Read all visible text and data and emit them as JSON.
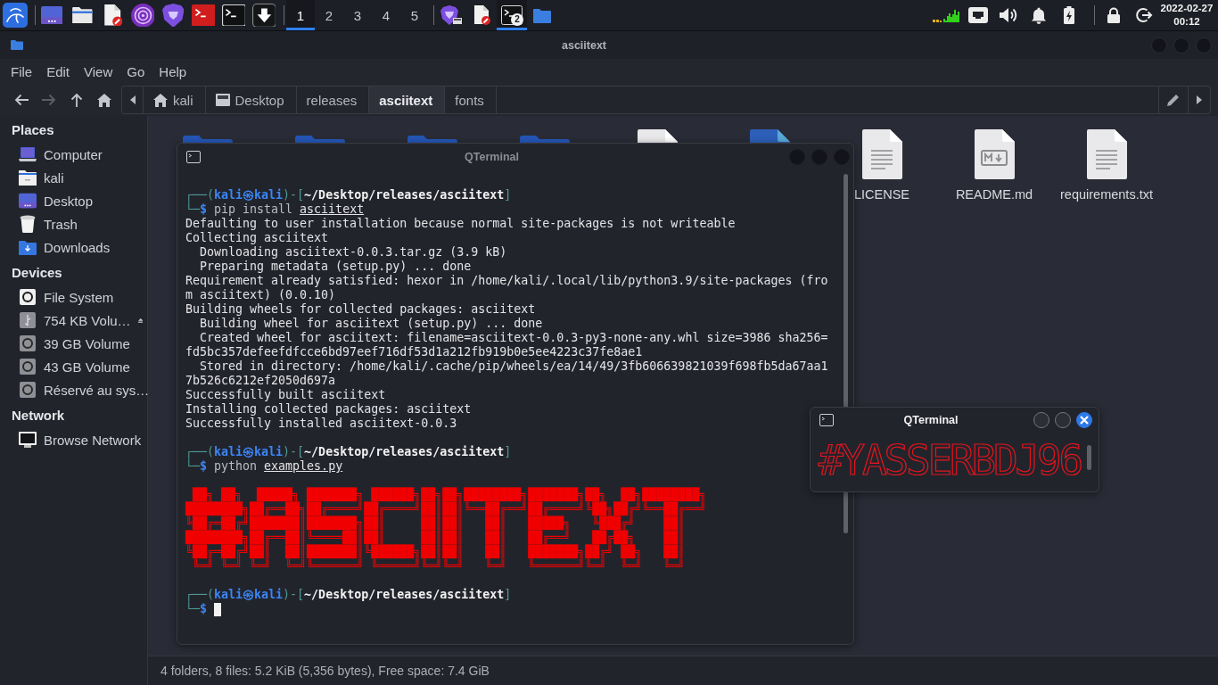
{
  "panel": {
    "launchers": [
      {
        "kind": "show_desktop"
      },
      {
        "kind": "files"
      },
      {
        "kind": "editor"
      },
      {
        "kind": "onion_browser"
      },
      {
        "kind": "browser"
      },
      {
        "kind": "root_terminal"
      },
      {
        "kind": "terminal"
      },
      {
        "kind": "downloader"
      }
    ],
    "workspaces": [
      {
        "label": "1",
        "selected": true
      },
      {
        "label": "2",
        "selected": false
      },
      {
        "label": "3",
        "selected": false
      },
      {
        "label": "4",
        "selected": false
      },
      {
        "label": "5",
        "selected": false
      }
    ],
    "tasks": [
      {
        "kind": "browser",
        "selected": false
      },
      {
        "kind": "editor",
        "selected": false
      },
      {
        "kind": "terminal",
        "badge": "2",
        "selected": true
      },
      {
        "kind": "files",
        "selected": false
      }
    ],
    "tray": [
      {
        "kind": "monitor"
      },
      {
        "kind": "network"
      },
      {
        "kind": "volume"
      },
      {
        "kind": "notifications"
      },
      {
        "kind": "battery"
      }
    ],
    "session": [
      {
        "kind": "lock"
      },
      {
        "kind": "logout"
      }
    ],
    "clock": {
      "date": "2022-02-27",
      "time": "00:12"
    }
  },
  "file_manager": {
    "title": "asciitext",
    "menu": [
      "File",
      "Edit",
      "View",
      "Go",
      "Help"
    ],
    "nav": [
      {
        "kind": "back",
        "disabled": false
      },
      {
        "kind": "forward",
        "disabled": true
      },
      {
        "kind": "up",
        "disabled": false
      },
      {
        "kind": "home",
        "disabled": false
      }
    ],
    "path": [
      {
        "label": "kali",
        "kind": "home",
        "selected": false
      },
      {
        "label": "Desktop",
        "kind": "desktop",
        "selected": false
      },
      {
        "label": "releases",
        "kind": "folder",
        "selected": false
      },
      {
        "label": "asciitext",
        "kind": "folder",
        "selected": true
      },
      {
        "label": "fonts",
        "kind": "folder",
        "selected": false
      }
    ],
    "sidebar": [
      {
        "heading": "Places",
        "items": [
          {
            "label": "Computer",
            "kind": "computer"
          },
          {
            "label": "kali",
            "kind": "home"
          },
          {
            "label": "Desktop",
            "kind": "desktop"
          },
          {
            "label": "Trash",
            "kind": "trash"
          },
          {
            "label": "Downloads",
            "kind": "downloads"
          }
        ]
      },
      {
        "heading": "Devices",
        "items": [
          {
            "label": "File System",
            "kind": "drive",
            "ejectable": false
          },
          {
            "label": "754 KB Volu…",
            "kind": "usb",
            "ejectable": true
          },
          {
            "label": "39 GB Volume",
            "kind": "disk",
            "ejectable": false
          },
          {
            "label": "43 GB Volume",
            "kind": "disk",
            "ejectable": false
          },
          {
            "label": "Réservé au sys…",
            "kind": "disk",
            "ejectable": false
          }
        ]
      },
      {
        "heading": "Network",
        "items": [
          {
            "label": "Browse Network",
            "kind": "network"
          }
        ]
      }
    ],
    "files": [
      {
        "kind": "folder"
      },
      {
        "kind": "folder"
      },
      {
        "kind": "folder"
      },
      {
        "kind": "folder"
      },
      {
        "kind": "text"
      },
      {
        "kind": "python"
      },
      {
        "kind": "text",
        "name": "LICENSE"
      },
      {
        "kind": "markdown",
        "name": "README.md"
      },
      {
        "kind": "text",
        "name": "requirements.txt"
      }
    ],
    "status": "4 folders, 8 files: 5.2 KiB (5,356 bytes), Free space: 7.4 GiB"
  },
  "terminals": [
    {
      "title": "QTerminal",
      "active": false,
      "lines": [
        {
          "kind": "prompt",
          "frame": "┌──(",
          "user": "kali㉿kali",
          "sep": ")-[",
          "path": "~/Desktop/releases/asciitext",
          "close": "]"
        },
        {
          "kind": "input",
          "frame": "└─",
          "sign": "$",
          "command": "pip install",
          "target": "asciitext",
          "cursor": false
        },
        {
          "kind": "output",
          "text": "Defaulting to user installation because normal site-packages is not writeable"
        },
        {
          "kind": "output",
          "text": "Collecting asciitext"
        },
        {
          "kind": "output",
          "text": "  Downloading asciitext-0.0.3.tar.gz (3.9 kB)"
        },
        {
          "kind": "output",
          "text": "  Preparing metadata (setup.py) ... done"
        },
        {
          "kind": "output",
          "text": "Requirement already satisfied: hexor in /home/kali/.local/lib/python3.9/site-packages (fro"
        },
        {
          "kind": "output",
          "text": "m asciitext) (0.0.10)"
        },
        {
          "kind": "output",
          "text": "Building wheels for collected packages: asciitext"
        },
        {
          "kind": "output",
          "text": "  Building wheel for asciitext (setup.py) ... done"
        },
        {
          "kind": "output",
          "text": "  Created wheel for asciitext: filename=asciitext-0.0.3-py3-none-any.whl size=3986 sha256="
        },
        {
          "kind": "output",
          "text": "fd5bc357defeefdfcce6bd97eef716df53d1a212fb919b0e5ee4223c37fe8ae1"
        },
        {
          "kind": "output",
          "text": "  Stored in directory: /home/kali/.cache/pip/wheels/ea/14/49/3fb606639821039f698fb5da67aa1"
        },
        {
          "kind": "output",
          "text": "7b526c6212ef2050d697a"
        },
        {
          "kind": "output",
          "text": "Successfully built asciitext"
        },
        {
          "kind": "output",
          "text": "Installing collected packages: asciitext"
        },
        {
          "kind": "output",
          "text": "Successfully installed asciitext-0.0.3"
        },
        {
          "kind": "blank"
        },
        {
          "kind": "prompt",
          "frame": "┌──(",
          "user": "kali㉿kali",
          "sep": ")-[",
          "path": "~/Desktop/releases/asciitext",
          "close": "]"
        },
        {
          "kind": "input",
          "frame": "└─",
          "sign": "$",
          "command": "python",
          "target": "examples.py",
          "cursor": false
        },
        {
          "kind": "blank"
        },
        {
          "kind": "art",
          "text": " ██╗ ██╗  █████╗ ███████╗ ██████╗██╗██╗████████╗███████╗██╗  ██╗████████╗"
        },
        {
          "kind": "art",
          "text": "████████╗██╔══██╗██╔════╝██╔════╝██║██║╚══██╔══╝██╔════╝╚██╗██╔╝╚══██╔══╝"
        },
        {
          "kind": "art",
          "text": "╚██╔═██╔╝███████║███████╗██║     ██║██║   ██║   █████╗   ╚███╔╝    ██║"
        },
        {
          "kind": "art",
          "text": "████████╗██╔══██║╚════██║██║     ██║██║   ██║   ██╔══╝   ██╔██╗    ██║"
        },
        {
          "kind": "art",
          "text": "╚██╔═██╔╝██║  ██║███████║╚██████╗██║██║   ██║   ███████╗██╔╝ ██╗   ██║"
        },
        {
          "kind": "art",
          "text": " ╚═╝ ╚═╝ ╚═╝  ╚═╝╚══════╝ ╚═════╝╚═╝╚═╝   ╚═╝   ╚══════╝╚═╝  ╚═╝   ╚═╝"
        },
        {
          "kind": "blank"
        },
        {
          "kind": "prompt",
          "frame": "┌──(",
          "user": "kali㉿kali",
          "sep": ")-[",
          "path": "~/Desktop/releases/asciitext",
          "close": "]"
        },
        {
          "kind": "input",
          "frame": "└─",
          "sign": "$",
          "cursor": true
        }
      ]
    },
    {
      "title": "QTerminal",
      "active": true,
      "banner": "#YASSERBDJ96"
    }
  ]
}
